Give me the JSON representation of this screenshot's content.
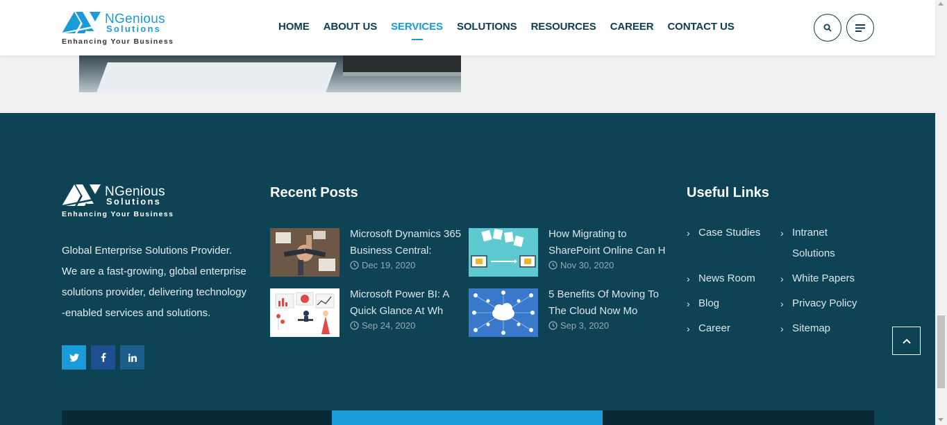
{
  "colors": {
    "brand_blue": "#1a9bd7",
    "navy": "#0e3a52",
    "footer_bg": "#0e4356"
  },
  "header": {
    "logo": {
      "main": "NGenious",
      "sub": "Solutions",
      "tagline": "Enhancing Your Business"
    },
    "nav": [
      {
        "label": "HOME",
        "active": false
      },
      {
        "label": "ABOUT US",
        "active": false
      },
      {
        "label": "SERVICES",
        "active": true
      },
      {
        "label": "SOLUTIONS",
        "active": false
      },
      {
        "label": "RESOURCES",
        "active": false
      },
      {
        "label": "CAREER",
        "active": false
      },
      {
        "label": "CONTACT US",
        "active": false
      }
    ],
    "search_icon": "search-icon",
    "menu_icon": "hamburger-menu-icon"
  },
  "footer": {
    "logo": {
      "main": "NGenious",
      "sub": "Solutions",
      "tagline": "Enhancing Your Business"
    },
    "description_lines": [
      "Global Enterprise Solutions Provider.",
      "We are a fast-growing, global enterprise",
      "solutions provider, delivering technology",
      "-enabled services and solutions."
    ],
    "social": [
      {
        "icon": "twitter-icon",
        "color": "#1a9bd7"
      },
      {
        "icon": "facebook-icon",
        "color": "#1d4f91"
      },
      {
        "icon": "linkedin-icon",
        "color": "#1b5f8a"
      }
    ],
    "recent_posts": {
      "title": "Recent Posts",
      "posts": [
        {
          "title": "Microsoft Dynamics 365 Business Central:",
          "date": "Dec 19, 2020"
        },
        {
          "title": "How Migrating to SharePoint Online Can H",
          "date": "Nov 30, 2020"
        },
        {
          "title": "Microsoft Power BI: A Quick Glance At Wh",
          "date": "Sep 24, 2020"
        },
        {
          "title": "5 Benefits Of Moving To The Cloud Now Mo",
          "date": "Sep 3, 2020"
        }
      ]
    },
    "useful_links": {
      "title": "Useful Links",
      "col1": [
        "Case Studies",
        "News Room",
        "Blog",
        "Career"
      ],
      "col2": [
        "Intranet Solutions",
        "White Papers",
        "Privacy Policy",
        "Sitemap"
      ]
    }
  }
}
